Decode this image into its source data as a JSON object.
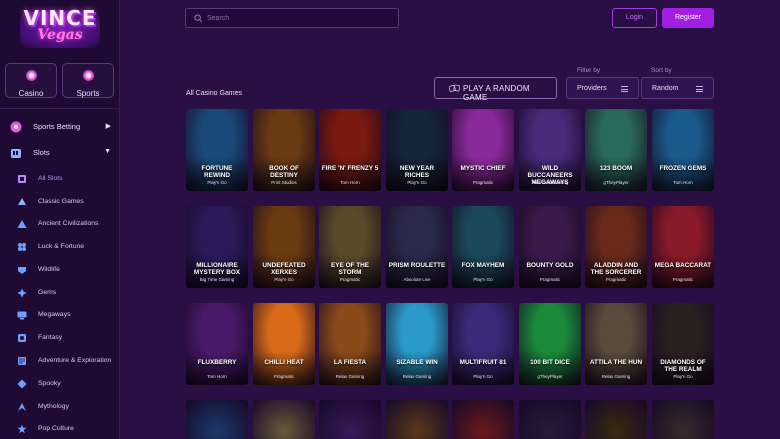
{
  "brand": {
    "logo_top": "VINCE",
    "logo_bottom": "Vegas"
  },
  "category_buttons": [
    {
      "label": "Casino"
    },
    {
      "label": "Sports"
    }
  ],
  "sidebar": {
    "sports_betting": "Sports Betting",
    "slots": "Slots",
    "sub_items": [
      {
        "label": "All Slots",
        "icon": "slot-reel-icon"
      },
      {
        "label": "Classic Games",
        "icon": "classic-icon"
      },
      {
        "label": "Ancient Civilizations",
        "icon": "pyramid-icon"
      },
      {
        "label": "Luck & Fortune",
        "icon": "clover-icon"
      },
      {
        "label": "Wildlife",
        "icon": "wildlife-icon"
      },
      {
        "label": "Gems",
        "icon": "gem-icon"
      },
      {
        "label": "Megaways",
        "icon": "megaways-icon"
      },
      {
        "label": "Fantasy",
        "icon": "fantasy-icon"
      },
      {
        "label": "Adventure & Exploration",
        "icon": "compass-icon"
      },
      {
        "label": "Spooky",
        "icon": "ghost-icon"
      },
      {
        "label": "Mythology",
        "icon": "mythology-icon"
      },
      {
        "label": "Pop Culture",
        "icon": "star-icon"
      }
    ]
  },
  "header": {
    "search_placeholder": "Search",
    "login": "Login",
    "register": "Register"
  },
  "toolbar": {
    "heading": "All Casino Games",
    "random_game": "PLAY A RANDOM GAME",
    "filter_label": "Filter by",
    "filter_value": "Providers",
    "sort_label": "Sort by",
    "sort_value": "Random"
  },
  "games": [
    {
      "name": "Fortune Rewind",
      "provider": "Play'n Go",
      "bg": "#1a4a7a"
    },
    {
      "name": "Book of Destiny",
      "provider": "Print Studios",
      "bg": "#6a3a12"
    },
    {
      "name": "Fire 'N' Frenzy 5",
      "provider": "Tom Horn",
      "bg": "#7a1a10"
    },
    {
      "name": "New Year Riches",
      "provider": "Play'n Go",
      "bg": "#14263a"
    },
    {
      "name": "Mystic Chief",
      "provider": "Pragmatic",
      "bg": "#8a2a9a"
    },
    {
      "name": "Wild Buccaneers Megaways",
      "provider": "Pear Leaf Gaming",
      "bg": "#4a2a7a"
    },
    {
      "name": "123 Boom",
      "provider": "gTheyPlayer",
      "bg": "#2a6a5a"
    },
    {
      "name": "Frozen Gems",
      "provider": "Tom Horn",
      "bg": "#1a5a8a"
    },
    {
      "name": "Millionaire Mystery Box",
      "provider": "Big Time Gaming",
      "bg": "#2a1a5a"
    },
    {
      "name": "Undefeated Xerxes",
      "provider": "Play'n Go",
      "bg": "#6a3a10"
    },
    {
      "name": "Eye of the Storm",
      "provider": "Pragmatic",
      "bg": "#5a4a2a"
    },
    {
      "name": "Prism Roulette",
      "provider": "Absolute Live",
      "bg": "#2a2a4a"
    },
    {
      "name": "Fox Mayhem",
      "provider": "Play'n Go",
      "bg": "#1a4a5a"
    },
    {
      "name": "Bounty Gold",
      "provider": "Pragmatic",
      "bg": "#3a1a4a"
    },
    {
      "name": "Aladdin and the Sorcerer",
      "provider": "Pragmatic",
      "bg": "#6a2a1a"
    },
    {
      "name": "Mega Baccarat",
      "provider": "Pragmatic",
      "bg": "#8a1a2a"
    },
    {
      "name": "Fluxberry",
      "provider": "Tom Horn",
      "bg": "#4a1a6a"
    },
    {
      "name": "Chilli Heat",
      "provider": "Pragmatic",
      "bg": "#d86a1a"
    },
    {
      "name": "La Fiesta",
      "provider": "Relax Gaming",
      "bg": "#8a4a1a"
    },
    {
      "name": "Sizable Win",
      "provider": "Relax Gaming",
      "bg": "#2a9ac8"
    },
    {
      "name": "Multifruit 81",
      "provider": "Play'n Go",
      "bg": "#3a2a7a"
    },
    {
      "name": "100 Bit Dice",
      "provider": "gTheyPlayer",
      "bg": "#1a8a3a"
    },
    {
      "name": "Attila the Hun",
      "provider": "Relax Gaming",
      "bg": "#5a4a3a"
    },
    {
      "name": "Diamonds of the Realm",
      "provider": "Play'n Go",
      "bg": "#2a2020"
    }
  ],
  "colors": {
    "accent": "#a01fe0",
    "background": "#2a0f44",
    "sidebar": "#1e0a33"
  }
}
